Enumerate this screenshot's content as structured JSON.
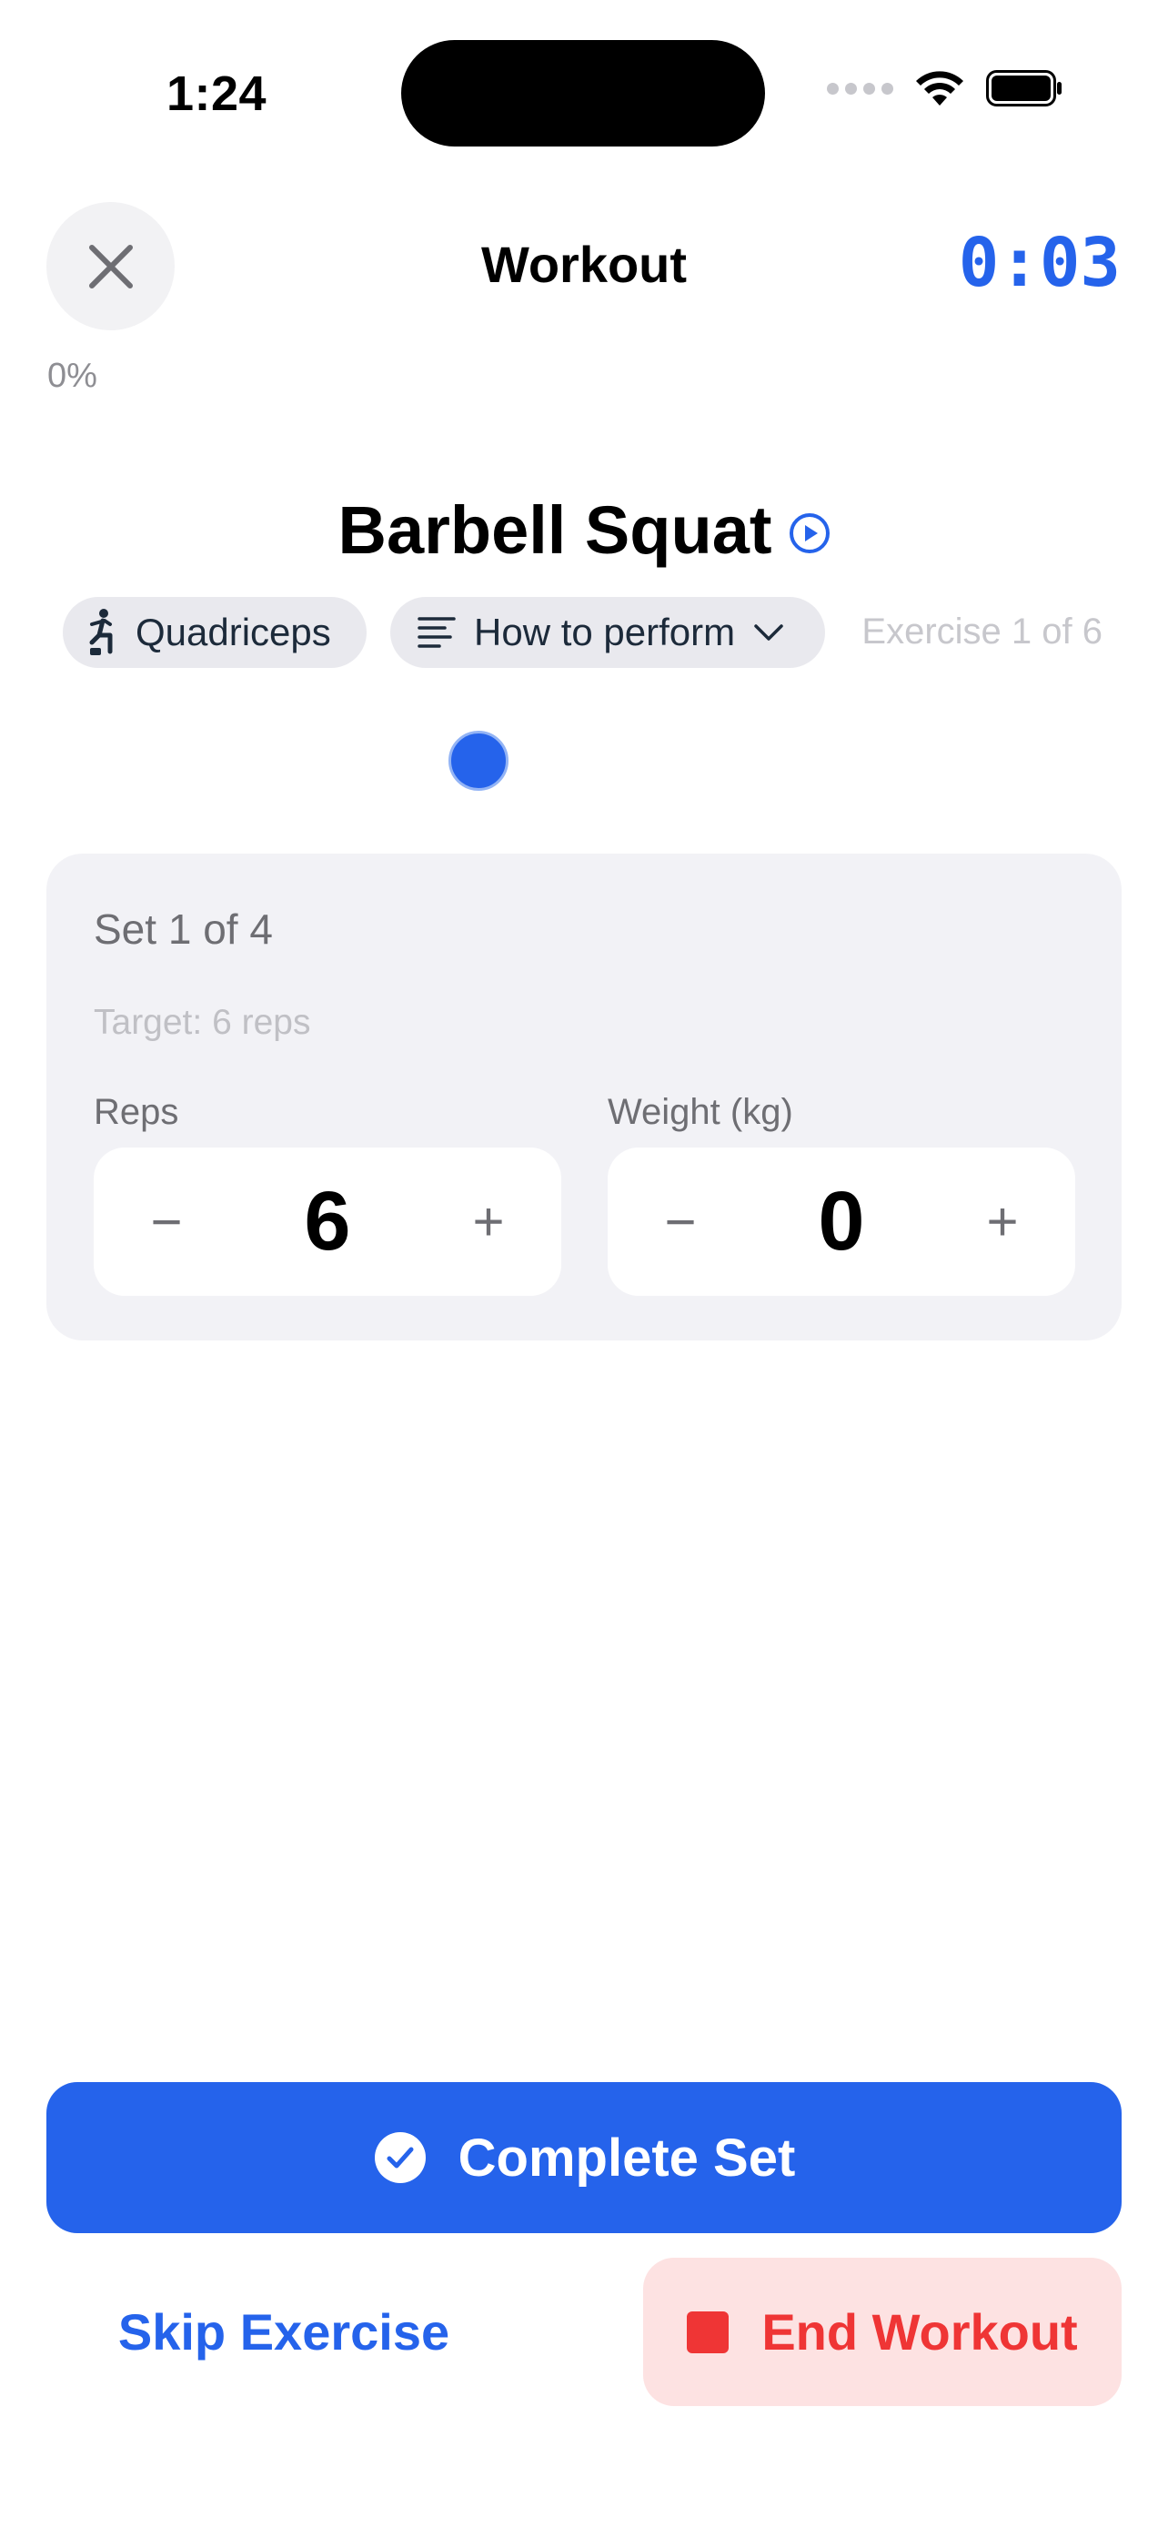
{
  "status_bar": {
    "time": "1:24"
  },
  "header": {
    "title": "Workout",
    "timer": "0:03",
    "progress_text": "0%",
    "progress_fraction": 0
  },
  "exercise": {
    "name": "Barbell Squat",
    "muscle_chip": "Quadriceps",
    "howto_chip": "How to perform",
    "count_text": "Exercise 1 of 6"
  },
  "set_card": {
    "set_text": "Set 1 of 4",
    "target_text": "Target: 6 reps",
    "reps": {
      "label": "Reps",
      "value": "6",
      "minus": "−",
      "plus": "+"
    },
    "weight": {
      "label": "Weight (kg)",
      "value": "0",
      "minus": "−",
      "plus": "+"
    }
  },
  "actions": {
    "complete_label": "Complete Set",
    "skip_label": "Skip Exercise",
    "end_label": "End Workout"
  },
  "colors": {
    "accent": "#2563eb",
    "danger": "#ef3535",
    "danger_bg": "#fde2e2",
    "card_bg": "#f2f2f6"
  },
  "icons": {
    "close": "close-icon",
    "play": "play-circle-icon",
    "muscle": "person-icon",
    "howto": "text-lines-icon",
    "dropdown": "chevron-down-icon",
    "complete": "check-circle-icon",
    "end": "stop-icon"
  }
}
